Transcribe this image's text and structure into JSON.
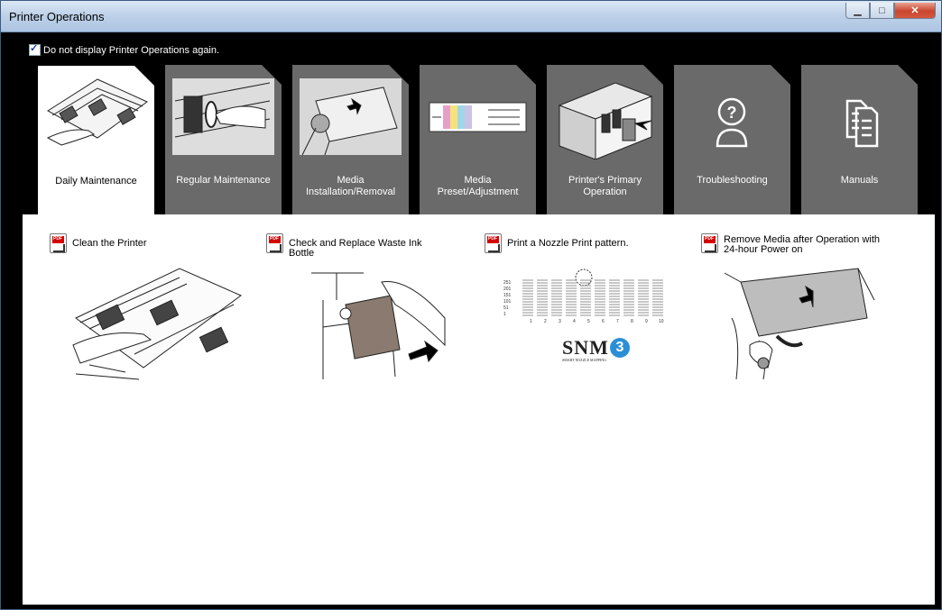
{
  "window": {
    "title": "Printer Operations",
    "min_icon": "minimize-icon",
    "max_icon": "maximize-icon",
    "close_icon": "close-icon"
  },
  "checkbox": {
    "label": "Do not display Printer Operations again.",
    "checked": true
  },
  "tabs": [
    {
      "label": "Daily Maintenance",
      "active": true
    },
    {
      "label": "Regular Maintenance",
      "active": false
    },
    {
      "label": "Media\nInstallation/Removal",
      "active": false
    },
    {
      "label": "Media Preset/Adjustment",
      "active": false
    },
    {
      "label": "Printer's Primary\nOperation",
      "active": false
    },
    {
      "label": "Troubleshooting",
      "active": false,
      "icon": "question-person-icon"
    },
    {
      "label": "Manuals",
      "active": false,
      "icon": "documents-icon"
    }
  ],
  "items": [
    {
      "label": "Clean the Printer",
      "icon": "pdf-icon"
    },
    {
      "label": "Check and Replace Waste Ink Bottle",
      "icon": "pdf-icon"
    },
    {
      "label": "Print a Nozzle Print pattern.",
      "icon": "pdf-icon"
    },
    {
      "label": "Remove Media after Operation with 24-hour Power on",
      "icon": "pdf-icon"
    }
  ],
  "nozzle_chart": {
    "y_ticks": [
      "251",
      "201",
      "151",
      "101",
      "51",
      "1"
    ],
    "x_ticks": [
      "1",
      "2",
      "3",
      "4",
      "5",
      "6",
      "7",
      "8",
      "9",
      "10"
    ],
    "logo": "SNM",
    "logo_sub": "SMART NOZZLE MAPPING"
  },
  "colors": {
    "tab_inactive": "#6a6a6a",
    "tab_active": "#ffffff",
    "background": "#000000",
    "pdf_red": "#d40000"
  }
}
